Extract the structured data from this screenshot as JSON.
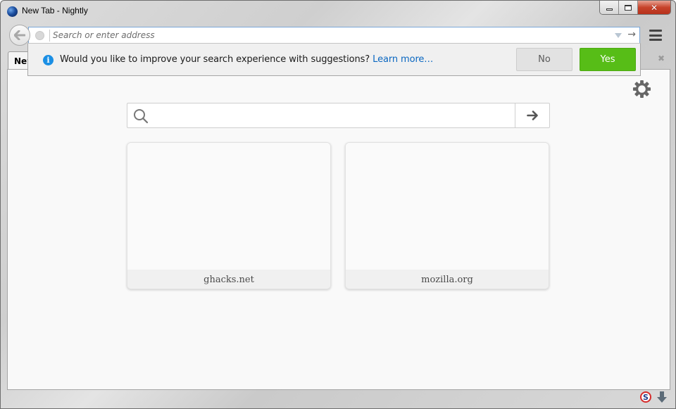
{
  "window": {
    "title": "New Tab - Nightly",
    "controls": {
      "minimize": "minimize",
      "maximize": "maximize",
      "close": "✕"
    }
  },
  "navbar": {
    "back_icon": "arrow-left-icon",
    "url_placeholder": "Search or enter address",
    "url_value": "",
    "go_arrow": "→",
    "menu_icon": "hamburger-menu-icon"
  },
  "tabs": [
    {
      "label": "New",
      "active": true
    }
  ],
  "tab_close": "✖",
  "notification": {
    "icon": "info-icon",
    "info_glyph": "i",
    "message": "Would you like to improve your search experience with suggestions?",
    "link": "Learn more…",
    "no_label": "No",
    "yes_label": "Yes",
    "colors": {
      "yes_bg": "#57bd17",
      "link": "#0a67c1",
      "info": "#1b8fe4"
    }
  },
  "newtab": {
    "settings_icon": "gear-icon",
    "search_placeholder": "",
    "search_value": "",
    "tiles": [
      {
        "label": "ghacks.net"
      },
      {
        "label": "mozilla.org"
      }
    ]
  },
  "statusbar": {
    "noscript_glyph": "S",
    "noscript_icon": "noscript-icon",
    "download_icon": "download-arrow-icon"
  }
}
